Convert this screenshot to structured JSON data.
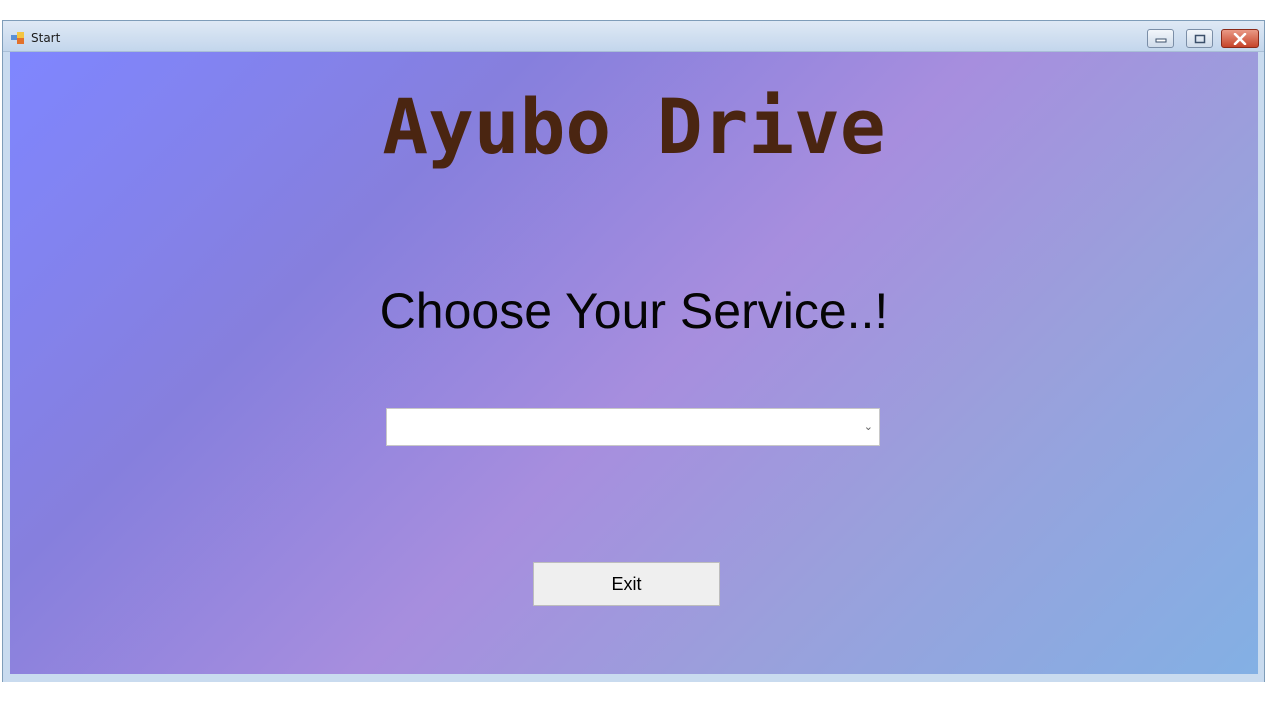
{
  "window": {
    "title": "Start",
    "controls": {
      "minimize": "minimize-icon",
      "maximize": "maximize-icon",
      "close": "close-icon"
    }
  },
  "form": {
    "app_title": "Ayubo Drive",
    "prompt": "Choose Your Service..!",
    "service_select": {
      "selected_value": "",
      "dropdown_icon": "chevron-down-icon"
    },
    "exit_label": "Exit"
  },
  "colors": {
    "title_color": "#4a2511",
    "prompt_color": "#050505",
    "gradient_start": "#7f86ff",
    "gradient_mid": "#a78ede",
    "gradient_end": "#83b0e4",
    "close_button": "#c6442a"
  }
}
